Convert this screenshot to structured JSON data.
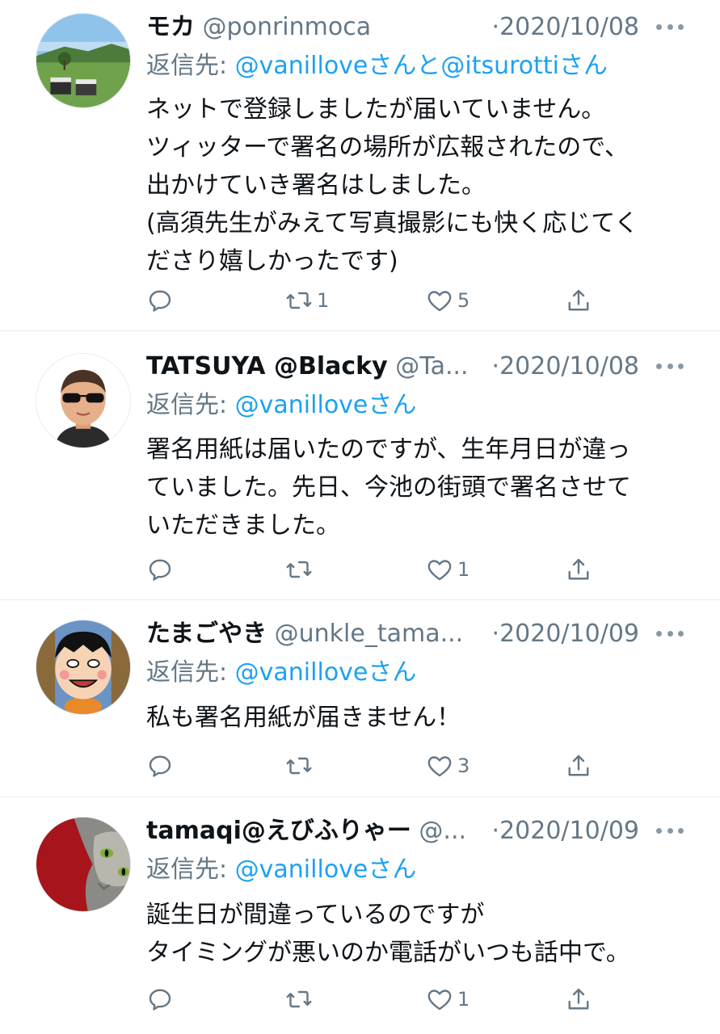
{
  "tweets": [
    {
      "name": "モカ",
      "handle": "@ponrinmoca",
      "date": "·2020/10/08",
      "reply_prefix": "返信先: ",
      "reply_mentions": "@vanilloveさんと@itsurottiさん",
      "text": "ネットで登録しましたが届いていません。\nツィッターで署名の場所が広報されたので、\n出かけていき署名はしました。\n(高須先生がみえて写真撮影にも快く応じてく\nださり嬉しかったです)",
      "reply_count": "",
      "retweet_count": "1",
      "like_count": "5",
      "avatar": "golf-course-photo"
    },
    {
      "name": "TATSUYA @Blacky",
      "handle": "@Ta...",
      "date": "·2020/10/08",
      "reply_prefix": "返信先: ",
      "reply_mentions": "@vanilloveさん",
      "text": "署名用紙は届いたのですが、生年月日が違っ\nていました。先日、今池の街頭で署名させて\nいただきました。",
      "reply_count": "",
      "retweet_count": "",
      "like_count": "1",
      "avatar": "memoji-sunglasses"
    },
    {
      "name": "たまごやき",
      "handle": "@unkle_tama...",
      "date": "·2020/10/09",
      "reply_prefix": "返信先: ",
      "reply_mentions": "@vanilloveさん",
      "text": "私も署名用紙が届きません！",
      "reply_count": "",
      "retweet_count": "",
      "like_count": "3",
      "avatar": "cartoon-boy"
    },
    {
      "name": "tamaqi@えびふりゃー",
      "handle": "@...",
      "date": "·2020/10/09",
      "reply_prefix": "返信先: ",
      "reply_mentions": "@vanilloveさん",
      "text": "誕生日が間違っているのですが\nタイミングが悪いのか電話がいつも話中で。",
      "reply_count": "",
      "retweet_count": "",
      "like_count": "1",
      "avatar": "cat-photo"
    }
  ],
  "icons": {
    "reply": "reply-icon",
    "retweet": "retweet-icon",
    "like": "heart-icon",
    "share": "share-icon",
    "more": "more-icon"
  },
  "colors": {
    "name": "#0f1419",
    "secondary": "#657786",
    "link": "#1da1f2",
    "divider": "#e6ecf0"
  }
}
